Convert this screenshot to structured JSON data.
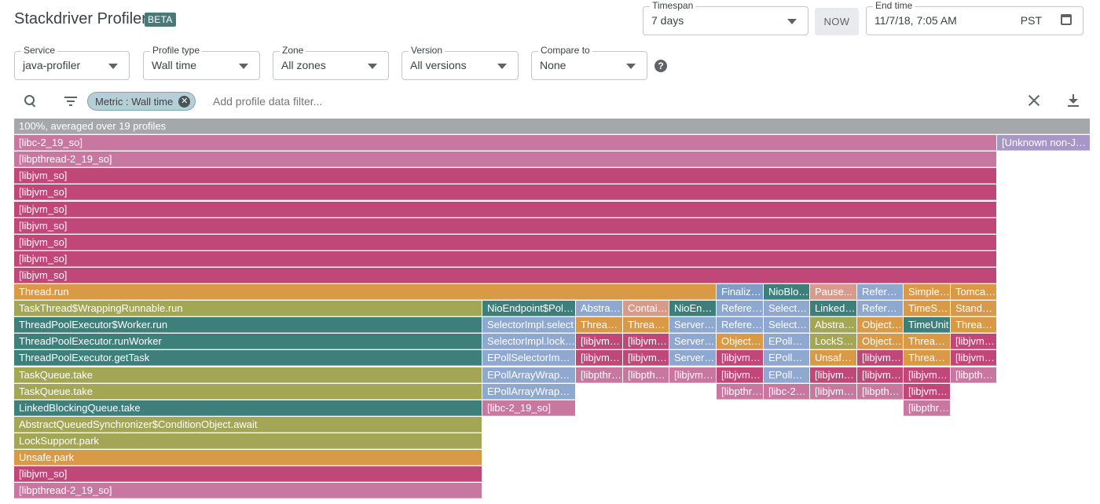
{
  "header": {
    "title": "Stackdriver Profiler",
    "badge": "BETA"
  },
  "timespan": {
    "label": "Timespan",
    "value": "7 days"
  },
  "now_button": "NOW",
  "end_time": {
    "label": "End time",
    "value": "11/7/18, 7:05 AM",
    "timezone": "PST"
  },
  "filters": {
    "service": {
      "label": "Service",
      "value": "java-profiler"
    },
    "profile_type": {
      "label": "Profile type",
      "value": "Wall time"
    },
    "zone": {
      "label": "Zone",
      "value": "All zones"
    },
    "version": {
      "label": "Version",
      "value": "All versions"
    },
    "compare_to": {
      "label": "Compare to",
      "value": "None"
    },
    "help_glyph": "?"
  },
  "toolbar": {
    "chip_label": "Metric : Wall time",
    "chip_close_glyph": "✕",
    "filter_placeholder": "Add profile data filter..."
  },
  "colors": {
    "root": "#a5a8ab",
    "magenta": "#c04878",
    "pink": "#c878a0",
    "orange": "#d99a47",
    "olive": "#a3a655",
    "teal": "#3e7f7b",
    "blue": "#7e9ec7",
    "lightblue": "#8fa8d0",
    "purple": "#a896c9",
    "salmon": "#d89a8a"
  },
  "flamegraph": {
    "frames": [
      {
        "row": 0,
        "start": 0,
        "end": 1370,
        "color": "root",
        "label": "100%, averaged over 19 profiles"
      },
      {
        "row": 1,
        "start": 0,
        "end": 1251,
        "color": "pink",
        "label": "[libc-2_19_so]"
      },
      {
        "row": 1,
        "start": 1251,
        "end": 1370,
        "color": "purple",
        "label": "[Unknown non-Java frame]"
      },
      {
        "row": 2,
        "start": 0,
        "end": 1251,
        "color": "pink",
        "label": "[libpthread-2_19_so]"
      },
      {
        "row": 3,
        "start": 0,
        "end": 1251,
        "color": "magenta",
        "label": "[libjvm_so]"
      },
      {
        "row": 4,
        "start": 0,
        "end": 1251,
        "color": "magenta",
        "label": "[libjvm_so]"
      },
      {
        "row": 5,
        "start": 0,
        "end": 1251,
        "color": "magenta",
        "label": "[libjvm_so]"
      },
      {
        "row": 6,
        "start": 0,
        "end": 1251,
        "color": "magenta",
        "label": "[libjvm_so]"
      },
      {
        "row": 7,
        "start": 0,
        "end": 1251,
        "color": "magenta",
        "label": "[libjvm_so]"
      },
      {
        "row": 8,
        "start": 0,
        "end": 1251,
        "color": "magenta",
        "label": "[libjvm_so]"
      },
      {
        "row": 9,
        "start": 0,
        "end": 1251,
        "color": "magenta",
        "label": "[libjvm_so]"
      },
      {
        "row": 10,
        "start": 0,
        "end": 894,
        "color": "orange",
        "label": "Thread.run"
      },
      {
        "row": 10,
        "start": 894,
        "end": 954,
        "color": "blue",
        "label": "Finalizer.run"
      },
      {
        "row": 10,
        "start": 954,
        "end": 1013,
        "color": "teal",
        "label": "NioBlockingSelector"
      },
      {
        "row": 10,
        "start": 1013,
        "end": 1073,
        "color": "salmon",
        "label": "Pause..."
      },
      {
        "row": 10,
        "start": 1073,
        "end": 1132,
        "color": "lightblue",
        "label": "Reference"
      },
      {
        "row": 10,
        "start": 1132,
        "end": 1192,
        "color": "orange",
        "label": "SimpleTimer"
      },
      {
        "row": 10,
        "start": 1192,
        "end": 1251,
        "color": "orange",
        "label": "TomcatThread"
      },
      {
        "row": 11,
        "start": 0,
        "end": 596,
        "color": "olive",
        "label": "TaskThread$WrappingRunnable.run"
      },
      {
        "row": 11,
        "start": 596,
        "end": 715,
        "color": "teal",
        "label": "NioEndpoint$Poller.run"
      },
      {
        "row": 11,
        "start": 715,
        "end": 775,
        "color": "lightblue",
        "label": "AbstractEndpoint"
      },
      {
        "row": 11,
        "start": 775,
        "end": 834,
        "color": "salmon",
        "label": "ContainerBackground"
      },
      {
        "row": 11,
        "start": 834,
        "end": 894,
        "color": "teal",
        "label": "NioEndpoint"
      },
      {
        "row": 11,
        "start": 894,
        "end": 954,
        "color": "lightblue",
        "label": "ReferenceQueue"
      },
      {
        "row": 11,
        "start": 954,
        "end": 1013,
        "color": "lightblue",
        "label": "SelectorImpl"
      },
      {
        "row": 11,
        "start": 1013,
        "end": 1073,
        "color": "teal",
        "label": "LinkedBlockingQueue"
      },
      {
        "row": 11,
        "start": 1073,
        "end": 1132,
        "color": "lightblue",
        "label": "ReferenceQueue"
      },
      {
        "row": 11,
        "start": 1132,
        "end": 1192,
        "color": "orange",
        "label": "TimeSource"
      },
      {
        "row": 11,
        "start": 1192,
        "end": 1251,
        "color": "orange",
        "label": "StandardThread"
      },
      {
        "row": 12,
        "start": 0,
        "end": 596,
        "color": "teal",
        "label": "ThreadPoolExecutor$Worker.run"
      },
      {
        "row": 12,
        "start": 596,
        "end": 715,
        "color": "lightblue",
        "label": "SelectorImpl.select"
      },
      {
        "row": 12,
        "start": 715,
        "end": 775,
        "color": "orange",
        "label": "Thread.sleep"
      },
      {
        "row": 12,
        "start": 775,
        "end": 834,
        "color": "orange",
        "label": "Thread.sleep"
      },
      {
        "row": 12,
        "start": 834,
        "end": 894,
        "color": "lightblue",
        "label": "ServerSocket"
      },
      {
        "row": 12,
        "start": 894,
        "end": 954,
        "color": "lightblue",
        "label": "ReferenceQueue"
      },
      {
        "row": 12,
        "start": 954,
        "end": 1013,
        "color": "lightblue",
        "label": "SelectorImpl"
      },
      {
        "row": 12,
        "start": 1013,
        "end": 1073,
        "color": "olive",
        "label": "AbstractQueued"
      },
      {
        "row": 12,
        "start": 1073,
        "end": 1132,
        "color": "orange",
        "label": "Object.wait"
      },
      {
        "row": 12,
        "start": 1132,
        "end": 1192,
        "color": "teal",
        "label": "TimeUnit"
      },
      {
        "row": 12,
        "start": 1192,
        "end": 1251,
        "color": "orange",
        "label": "Thread.sleep"
      },
      {
        "row": 13,
        "start": 0,
        "end": 596,
        "color": "teal",
        "label": "ThreadPoolExecutor.runWorker"
      },
      {
        "row": 13,
        "start": 596,
        "end": 715,
        "color": "lightblue",
        "label": "SelectorImpl.lockAndDoSelect"
      },
      {
        "row": 13,
        "start": 715,
        "end": 775,
        "color": "magenta",
        "label": "[libjvm_so]"
      },
      {
        "row": 13,
        "start": 775,
        "end": 834,
        "color": "magenta",
        "label": "[libjvm_so]"
      },
      {
        "row": 13,
        "start": 834,
        "end": 894,
        "color": "lightblue",
        "label": "ServerSocket"
      },
      {
        "row": 13,
        "start": 894,
        "end": 954,
        "color": "orange",
        "label": "Object.wait"
      },
      {
        "row": 13,
        "start": 954,
        "end": 1013,
        "color": "lightblue",
        "label": "EPollSelectorImpl"
      },
      {
        "row": 13,
        "start": 1013,
        "end": 1073,
        "color": "olive",
        "label": "LockSupport"
      },
      {
        "row": 13,
        "start": 1073,
        "end": 1132,
        "color": "orange",
        "label": "Object.wait"
      },
      {
        "row": 13,
        "start": 1132,
        "end": 1192,
        "color": "orange",
        "label": "Thread.sleep"
      },
      {
        "row": 13,
        "start": 1192,
        "end": 1251,
        "color": "magenta",
        "label": "[libjvm_so]"
      },
      {
        "row": 14,
        "start": 0,
        "end": 596,
        "color": "teal",
        "label": "ThreadPoolExecutor.getTask"
      },
      {
        "row": 14,
        "start": 596,
        "end": 715,
        "color": "lightblue",
        "label": "EPollSelectorImpl.doSelect"
      },
      {
        "row": 14,
        "start": 715,
        "end": 775,
        "color": "magenta",
        "label": "[libjvm_so]"
      },
      {
        "row": 14,
        "start": 775,
        "end": 834,
        "color": "magenta",
        "label": "[libjvm_so]"
      },
      {
        "row": 14,
        "start": 834,
        "end": 894,
        "color": "lightblue",
        "label": "ServerSocket"
      },
      {
        "row": 14,
        "start": 894,
        "end": 954,
        "color": "magenta",
        "label": "[libjvm_so]"
      },
      {
        "row": 14,
        "start": 954,
        "end": 1013,
        "color": "lightblue",
        "label": "EPollArrayWrapper"
      },
      {
        "row": 14,
        "start": 1013,
        "end": 1073,
        "color": "orange",
        "label": "Unsafe.park"
      },
      {
        "row": 14,
        "start": 1073,
        "end": 1132,
        "color": "magenta",
        "label": "[libjvm_so]"
      },
      {
        "row": 14,
        "start": 1132,
        "end": 1192,
        "color": "orange",
        "label": "Thread.sleep"
      },
      {
        "row": 14,
        "start": 1192,
        "end": 1251,
        "color": "magenta",
        "label": "[libjvm_so]"
      },
      {
        "row": 15,
        "start": 0,
        "end": 596,
        "color": "olive",
        "label": "TaskQueue.take"
      },
      {
        "row": 15,
        "start": 596,
        "end": 715,
        "color": "lightblue",
        "label": "EPollArrayWrapper.poll"
      },
      {
        "row": 15,
        "start": 715,
        "end": 775,
        "color": "pink",
        "label": "[libpthread-2_19_so]"
      },
      {
        "row": 15,
        "start": 775,
        "end": 834,
        "color": "pink",
        "label": "[libpthread-2_19_so]"
      },
      {
        "row": 15,
        "start": 834,
        "end": 894,
        "color": "pink",
        "label": "[libjvm_so]"
      },
      {
        "row": 15,
        "start": 894,
        "end": 954,
        "color": "magenta",
        "label": "[libjvm_so]"
      },
      {
        "row": 15,
        "start": 954,
        "end": 1013,
        "color": "lightblue",
        "label": "EPollArrayWrapper"
      },
      {
        "row": 15,
        "start": 1013,
        "end": 1073,
        "color": "magenta",
        "label": "[libjvm_so]"
      },
      {
        "row": 15,
        "start": 1073,
        "end": 1132,
        "color": "magenta",
        "label": "[libjvm_so]"
      },
      {
        "row": 15,
        "start": 1132,
        "end": 1192,
        "color": "magenta",
        "label": "[libjvm_so]"
      },
      {
        "row": 15,
        "start": 1192,
        "end": 1251,
        "color": "pink",
        "label": "[libpthread-2_19_so]"
      },
      {
        "row": 16,
        "start": 0,
        "end": 596,
        "color": "olive",
        "label": "TaskQueue.take"
      },
      {
        "row": 16,
        "start": 596,
        "end": 715,
        "color": "lightblue",
        "label": "EPollArrayWrapper.epollWait"
      },
      {
        "row": 16,
        "start": 894,
        "end": 954,
        "color": "pink",
        "label": "[libpthread-2_19_so]"
      },
      {
        "row": 16,
        "start": 954,
        "end": 1013,
        "color": "pink",
        "label": "[libc-2_19_so]"
      },
      {
        "row": 16,
        "start": 1013,
        "end": 1073,
        "color": "pink",
        "label": "[libjvm_so]"
      },
      {
        "row": 16,
        "start": 1073,
        "end": 1132,
        "color": "pink",
        "label": "[libpthread-2_19_so]"
      },
      {
        "row": 16,
        "start": 1132,
        "end": 1192,
        "color": "magenta",
        "label": "[libjvm_so]"
      },
      {
        "row": 17,
        "start": 0,
        "end": 596,
        "color": "teal",
        "label": "LinkedBlockingQueue.take"
      },
      {
        "row": 17,
        "start": 596,
        "end": 715,
        "color": "pink",
        "label": "[libc-2_19_so]"
      },
      {
        "row": 17,
        "start": 1132,
        "end": 1192,
        "color": "pink",
        "label": "[libpthread-2_19_so]"
      },
      {
        "row": 18,
        "start": 0,
        "end": 596,
        "color": "olive",
        "label": "AbstractQueuedSynchronizer$ConditionObject.await"
      },
      {
        "row": 19,
        "start": 0,
        "end": 596,
        "color": "olive",
        "label": "LockSupport.park"
      },
      {
        "row": 20,
        "start": 0,
        "end": 596,
        "color": "orange",
        "label": "Unsafe.park"
      },
      {
        "row": 21,
        "start": 0,
        "end": 596,
        "color": "magenta",
        "label": "[libjvm_so]"
      },
      {
        "row": 22,
        "start": 0,
        "end": 596,
        "color": "pink",
        "label": "[libpthread-2_19_so]"
      }
    ]
  }
}
